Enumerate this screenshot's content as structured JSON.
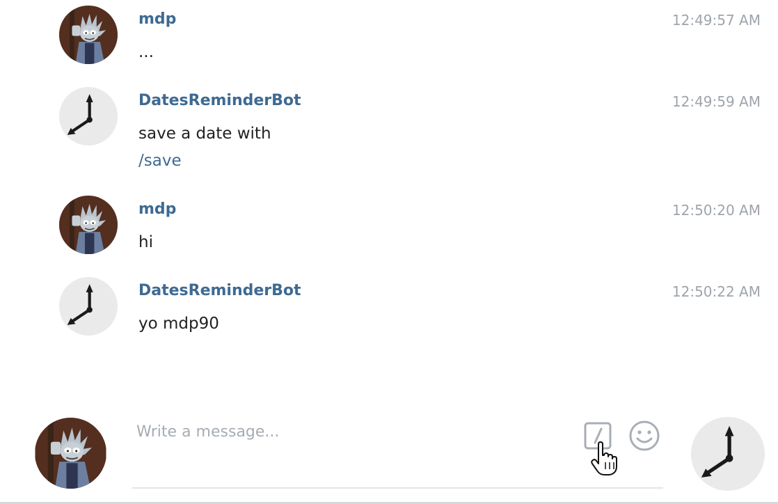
{
  "messages": [
    {
      "author": "mdp",
      "time": "12:49:57 AM",
      "text": "...",
      "avatar_icon": "rick-avatar"
    },
    {
      "author": "DatesReminderBot",
      "time": "12:49:59 AM",
      "text": "save a date with",
      "command": "/save",
      "avatar_icon": "clock-avatar"
    },
    {
      "author": "mdp",
      "time": "12:50:20 AM",
      "text": "hi",
      "avatar_icon": "rick-avatar"
    },
    {
      "author": "DatesReminderBot",
      "time": "12:50:22 AM",
      "text": "yo mdp90",
      "avatar_icon": "clock-avatar"
    }
  ],
  "composer": {
    "placeholder": "Write a message...",
    "value": "",
    "icons": [
      "command-icon",
      "emoji-icon",
      "hand-cursor-icon"
    ]
  },
  "colors": {
    "author": "#3e6a92",
    "timestamp": "#9ea4ab",
    "command_link": "#3e6a92",
    "avatar_bot_bg": "#eaeaea",
    "icon_gray": "#a8aeb5"
  }
}
